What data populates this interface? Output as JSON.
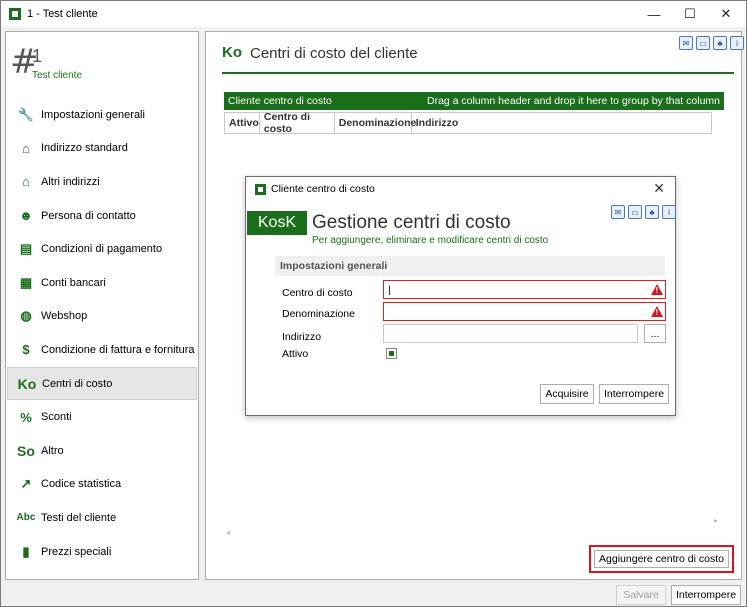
{
  "window": {
    "title": "1 - Test cliente",
    "minimize": "—",
    "maximize": "☐",
    "close": "✕"
  },
  "record": {
    "hash": "#",
    "number": "1",
    "name": "Test cliente"
  },
  "sidebar": {
    "items": [
      {
        "label": "Impostazioni generali",
        "icon": "wrench-icon"
      },
      {
        "label": "Indirizzo standard",
        "icon": "home-icon"
      },
      {
        "label": "Altri indirizzi",
        "icon": "houses-icon"
      },
      {
        "label": "Persona di contatto",
        "icon": "person-icon"
      },
      {
        "label": "Condizioni di pagamento",
        "icon": "register-icon"
      },
      {
        "label": "Conti bancari",
        "icon": "bank-icon"
      },
      {
        "label": "Webshop",
        "icon": "globe-icon"
      },
      {
        "label": "Condizione di fattura e fornitura",
        "icon": "money-icon"
      },
      {
        "label": "Centri di costo",
        "icon": "ko-icon",
        "text": "Ko"
      },
      {
        "label": "Sconti",
        "icon": "percent-icon"
      },
      {
        "label": "Altro",
        "icon": "so-icon",
        "text": "So"
      },
      {
        "label": "Codice statistica",
        "icon": "chart-icon"
      },
      {
        "label": "Testi del cliente",
        "icon": "abc-icon",
        "text": "Abc"
      },
      {
        "label": "Prezzi speciali",
        "icon": "bars-icon"
      }
    ],
    "active_index": 8
  },
  "main": {
    "ko": "Ko",
    "title": "Centri di costo del cliente",
    "grid": {
      "header_left": "Cliente centro di costo",
      "header_right": "Drag a column header and drop it here to group by that column",
      "columns": [
        "Attivo",
        "Centro di costo",
        "Denominazione",
        "Indirizzo"
      ]
    },
    "add_button": "Aggiungere centro di costo"
  },
  "footer": {
    "save": "Salvare",
    "cancel": "Interrompere"
  },
  "dialog": {
    "title": "Cliente centro di costo",
    "badge": "KosK",
    "heading": "Gestione centri di costo",
    "subtitle": "Per aggiungere, eliminare e modificare centri di costo",
    "section": "Impostazioni generali",
    "fields": {
      "cost_center": {
        "label": "Centro di costo",
        "value": "|"
      },
      "denomination": {
        "label": "Denominazione",
        "value": ""
      },
      "address": {
        "label": "Indirizzo",
        "value": ""
      },
      "active": {
        "label": "Attivo"
      }
    },
    "browse": "...",
    "acquire": "Acquisire",
    "cancel": "Interrompere",
    "close": "✕"
  },
  "colors": {
    "brand_green": "#1b6e1b",
    "error_red": "#d9141e"
  }
}
